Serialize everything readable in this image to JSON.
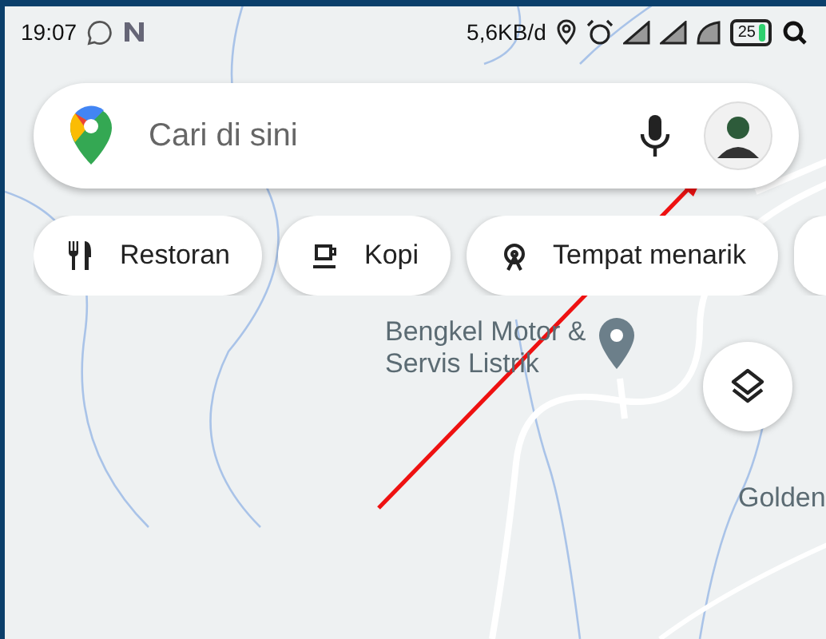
{
  "status_bar": {
    "time": "19:07",
    "speed": "5,6KB/d",
    "battery": "25"
  },
  "search": {
    "placeholder": "Cari di sini"
  },
  "chips": [
    {
      "label": "Restoran",
      "kind": "food"
    },
    {
      "label": "Kopi",
      "kind": "coffee"
    },
    {
      "label": "Tempat menarik",
      "kind": "attraction"
    }
  ],
  "map": {
    "kind": "picture",
    "places": [
      {
        "label": "Bengkel Motor & Servis Listrik",
        "kind": "pin"
      },
      {
        "label": "Golden",
        "kind": "plain"
      }
    ]
  }
}
